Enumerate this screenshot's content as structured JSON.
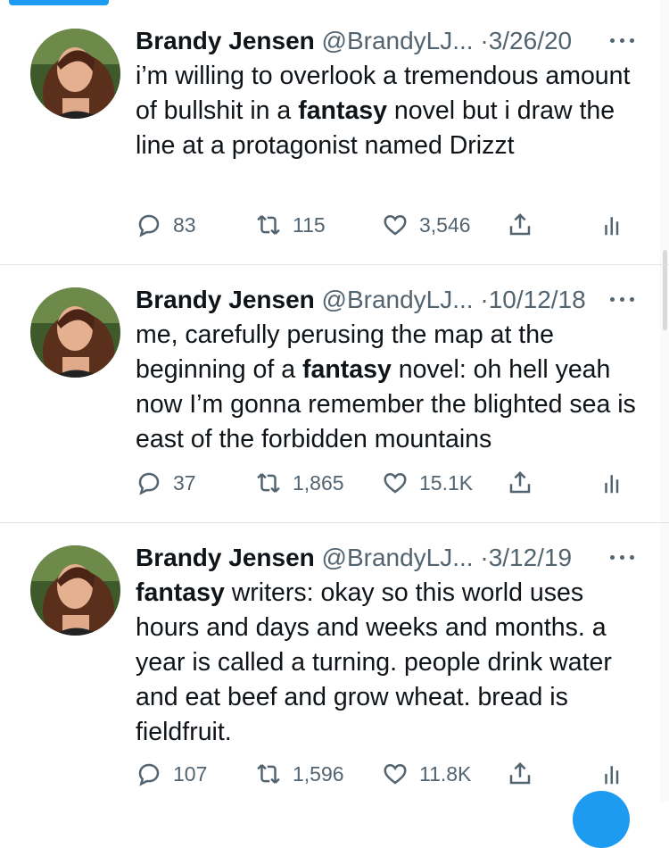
{
  "tweets": [
    {
      "author_name": "Brandy Jensen",
      "handle": "@BrandyLJ...",
      "separator": "·",
      "date": "3/26/20",
      "text_before": "i’m willing to overlook a tremendous amount of bullshit in a ",
      "text_bold": "fantasy",
      "text_after": " novel but i draw the line at a protagonist named Drizzt",
      "replies": "83",
      "retweets": "115",
      "likes": "3,546"
    },
    {
      "author_name": "Brandy Jensen",
      "handle": "@BrandyLJ...",
      "separator": "·",
      "date": "10/12/18",
      "text_before": "me, carefully perusing the map at the beginning of a ",
      "text_bold": "fantasy",
      "text_after": " novel: oh hell yeah now I’m gonna remember the blighted sea is east of the forbidden mountains",
      "replies": "37",
      "retweets": "1,865",
      "likes": "15.1K"
    },
    {
      "author_name": "Brandy Jensen",
      "handle": "@BrandyLJ...",
      "separator": "·",
      "date": "3/12/19",
      "text_before": "",
      "text_bold": "fantasy",
      "text_after": " writers: okay so this world uses hours and days and weeks and months. a year is called a turning. people drink water and eat beef and grow wheat. bread is fieldfruit.",
      "replies": "107",
      "retweets": "1,596",
      "likes": "11.8K"
    }
  ],
  "icons": {
    "reply": "reply-icon",
    "retweet": "retweet-icon",
    "like": "heart-icon",
    "share": "share-icon",
    "analytics": "analytics-icon",
    "more": "more-icon"
  },
  "colors": {
    "accent": "#1d9bf0",
    "secondary_text": "#536471",
    "primary_text": "#0f1419",
    "divider": "#e1e4e8"
  }
}
